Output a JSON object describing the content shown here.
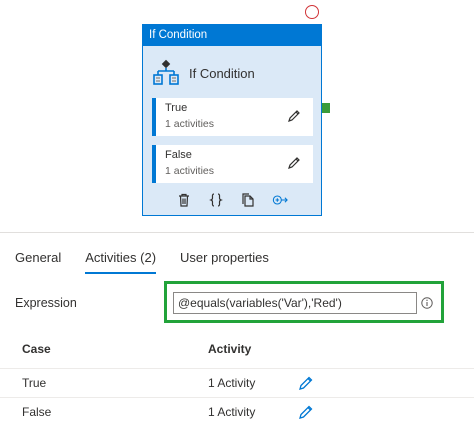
{
  "node": {
    "header_title": "If Condition",
    "type_label": "If Condition",
    "cases": [
      {
        "name": "True",
        "count": "1 activities"
      },
      {
        "name": "False",
        "count": "1 activities"
      }
    ]
  },
  "tabs": [
    {
      "label": "General",
      "active": false
    },
    {
      "label": "Activities (2)",
      "active": true
    },
    {
      "label": "User properties",
      "active": false
    }
  ],
  "expression": {
    "label": "Expression",
    "value": "@equals(variables('Var'),'Red')"
  },
  "table": {
    "headers": {
      "case": "Case",
      "activity": "Activity"
    },
    "rows": [
      {
        "case": "True",
        "activity": "1 Activity"
      },
      {
        "case": "False",
        "activity": "1 Activity"
      }
    ]
  },
  "colors": {
    "accent": "#0078d4",
    "node_background": "#dbe9f7",
    "highlight": "#22a33a",
    "error_circle": "#d13438"
  }
}
